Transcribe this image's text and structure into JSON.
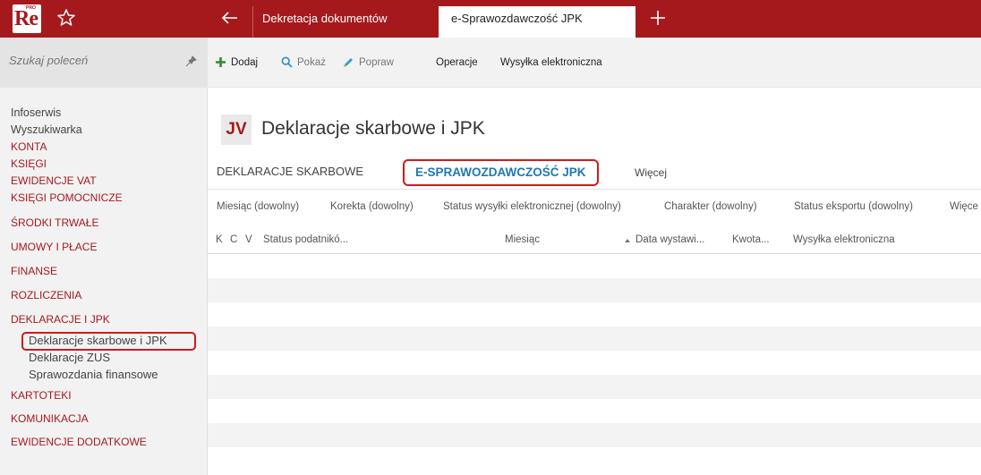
{
  "app": {
    "logo_text": "Re",
    "logo_sup": "PRO",
    "tabs": [
      {
        "label": "Dekretacja dokumentów"
      },
      {
        "label": "e-Sprawozdawczość JPK"
      }
    ]
  },
  "sidebar": {
    "search_placeholder": "Szukaj poleceń",
    "items": [
      {
        "label": "Infoserwis",
        "type": "plain"
      },
      {
        "label": "Wyszukiwarka",
        "type": "plain"
      },
      {
        "label": "KONTA",
        "type": "cat"
      },
      {
        "label": "KSIĘGI",
        "type": "cat"
      },
      {
        "label": "EWIDENCJE VAT",
        "type": "cat"
      },
      {
        "label": "KSIĘGI POMOCNICZE",
        "type": "cat"
      },
      {
        "label": "ŚRODKI TRWAŁE",
        "type": "cat"
      },
      {
        "label": "UMOWY I PŁACE",
        "type": "cat"
      },
      {
        "label": "FINANSE",
        "type": "cat"
      },
      {
        "label": "ROZLICZENIA",
        "type": "cat"
      },
      {
        "label": "DEKLARACJE I JPK",
        "type": "cat"
      },
      {
        "label": "Deklaracje skarbowe i JPK",
        "type": "sub"
      },
      {
        "label": "Deklaracje ZUS",
        "type": "sub"
      },
      {
        "label": "Sprawozdania finansowe",
        "type": "sub"
      },
      {
        "label": "KARTOTEKI",
        "type": "cat"
      },
      {
        "label": "KOMUNIKACJA",
        "type": "cat"
      },
      {
        "label": "EWIDENCJE DODATKOWE",
        "type": "cat"
      }
    ]
  },
  "toolbar": {
    "add": "Dodaj",
    "show": "Pokaż",
    "edit": "Popraw",
    "operations": "Operacje",
    "eship": "Wysyłka elektroniczna"
  },
  "page": {
    "badge": "JV",
    "title": "Deklaracje skarbowe i JPK",
    "tabs": {
      "tab1": "DEKLARACJE SKARBOWE",
      "tab2": "E-SPRAWOZDAWCZOŚĆ JPK",
      "more": "Więcej"
    }
  },
  "filters": {
    "f1": "Miesiąc (dowolny)",
    "f2": "Korekta (dowolny)",
    "f3": "Status wysyłki elektronicznej (dowolny)",
    "f4": "Charakter (dowolny)",
    "f5": "Status eksportu (dowolny)",
    "f6": "Więce"
  },
  "grid": {
    "columns": {
      "k": "K",
      "c": "C",
      "v": "V",
      "status": "Status podatnikó...",
      "month": "Miesiąc",
      "date": "Data wystawi...",
      "amount": "Kwota...",
      "eship": "Wysyłka elektroniczna"
    }
  },
  "colors": {
    "brand": "#a5191d",
    "highlight": "#d11a1a",
    "active_tab": "#1f77b4",
    "add_icon": "#2e8b2e",
    "search_icon": "#3a8fd1",
    "edit_icon": "#2f9fd8"
  }
}
